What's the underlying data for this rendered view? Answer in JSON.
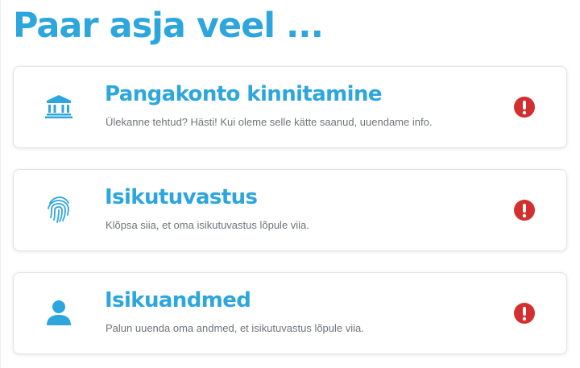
{
  "header": {
    "title": "Paar asja veel ..."
  },
  "colors": {
    "accent": "#2da6dd",
    "alert": "#d32f2f",
    "text_muted": "#6f7479"
  },
  "tasks": [
    {
      "icon": "bank-icon",
      "title": "Pangakonto kinnitamine",
      "description": "Ülekanne tehtud? Hästi! Kui oleme selle kätte saanud, uuendame info.",
      "status_icon": "alert-icon"
    },
    {
      "icon": "fingerprint-icon",
      "title": "Isikutuvastus",
      "description": "Klõpsa siia, et oma isikutuvastus lõpule viia.",
      "status_icon": "alert-icon"
    },
    {
      "icon": "person-icon",
      "title": "Isikuandmed",
      "description": "Palun uuenda oma andmed, et isikutuvastus lõpule viia.",
      "status_icon": "alert-icon"
    }
  ]
}
